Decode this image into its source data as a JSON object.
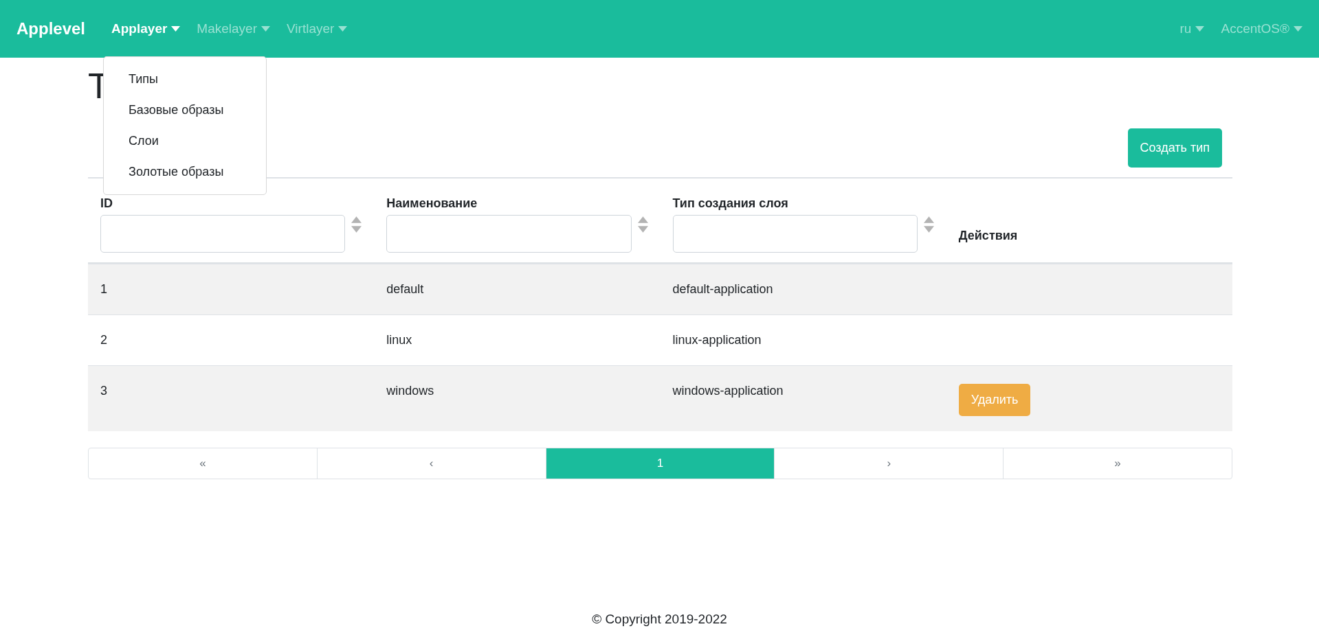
{
  "navbar": {
    "brand": "Applevel",
    "menus": [
      {
        "label": "Applayer",
        "active": true,
        "items": [
          "Типы",
          "Базовые образы",
          "Слои",
          "Золотые образы"
        ]
      },
      {
        "label": "Makelayer",
        "active": false
      },
      {
        "label": "Virtlayer",
        "active": false
      }
    ],
    "right_menus": [
      {
        "label": "ru",
        "active": false
      },
      {
        "label": "AccentOS®",
        "active": false
      }
    ]
  },
  "page": {
    "title": "Т",
    "create_button": "Создать тип"
  },
  "table": {
    "columns": [
      {
        "label": "ID",
        "kind": "filter"
      },
      {
        "label": "Наименование",
        "kind": "filter"
      },
      {
        "label": "Тип создания слоя",
        "kind": "filter"
      },
      {
        "label": "Действия",
        "kind": "plain"
      }
    ],
    "rows": [
      {
        "cells": [
          "1",
          "default",
          "default-application"
        ]
      },
      {
        "cells": [
          "2",
          "linux",
          "linux-application"
        ]
      },
      {
        "cells": [
          "3",
          "windows",
          "windows-application"
        ],
        "action": "Удалить"
      }
    ]
  },
  "pagination": [
    {
      "label": "«",
      "selected": false
    },
    {
      "label": "‹",
      "selected": false
    },
    {
      "label": "1",
      "selected": true
    },
    {
      "label": "›",
      "selected": false
    },
    {
      "label": "»",
      "selected": false
    }
  ],
  "footer": "© Copyright 2019-2022"
}
